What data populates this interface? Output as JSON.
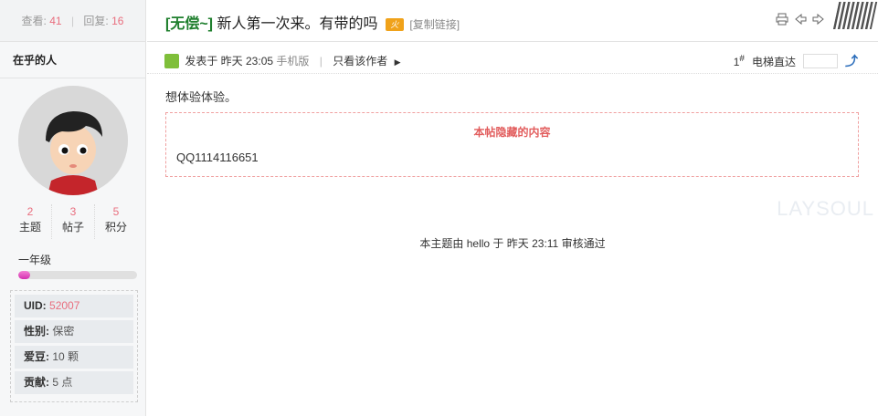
{
  "stats": {
    "views_label": "查看:",
    "views": "41",
    "replies_label": "回复:",
    "replies": "16"
  },
  "author": {
    "name": "在乎的人",
    "counts": [
      {
        "value": "2",
        "label": "主题"
      },
      {
        "value": "3",
        "label": "帖子"
      },
      {
        "value": "5",
        "label": "积分"
      }
    ],
    "level": "一年级",
    "level_progress": 0.1,
    "info": [
      {
        "key": "UID:",
        "value": "52007"
      },
      {
        "key": "性别:",
        "value": "保密"
      },
      {
        "key": "爱豆:",
        "value": "10 颗"
      },
      {
        "key": "贡献:",
        "value": "5 点"
      }
    ]
  },
  "thread": {
    "tag": "[无偿~]",
    "title": "新人第一次来。有带的吗",
    "hot_badge": "火",
    "copy_link": "[复制链接]"
  },
  "post": {
    "posted_prefix": "发表于 昨天 23:05",
    "mobile": "手机版",
    "only_author": "只看该作者",
    "floor": "1",
    "floor_suffix": "#",
    "elevator": "电梯直达",
    "body": "想体验体验。",
    "hidden_title": "本帖隐藏的内容",
    "hidden_content": "QQ1114116651",
    "watermark": "LAYSOUL",
    "approved": "本主题由 hello 于 昨天 23:11 审核通过"
  }
}
